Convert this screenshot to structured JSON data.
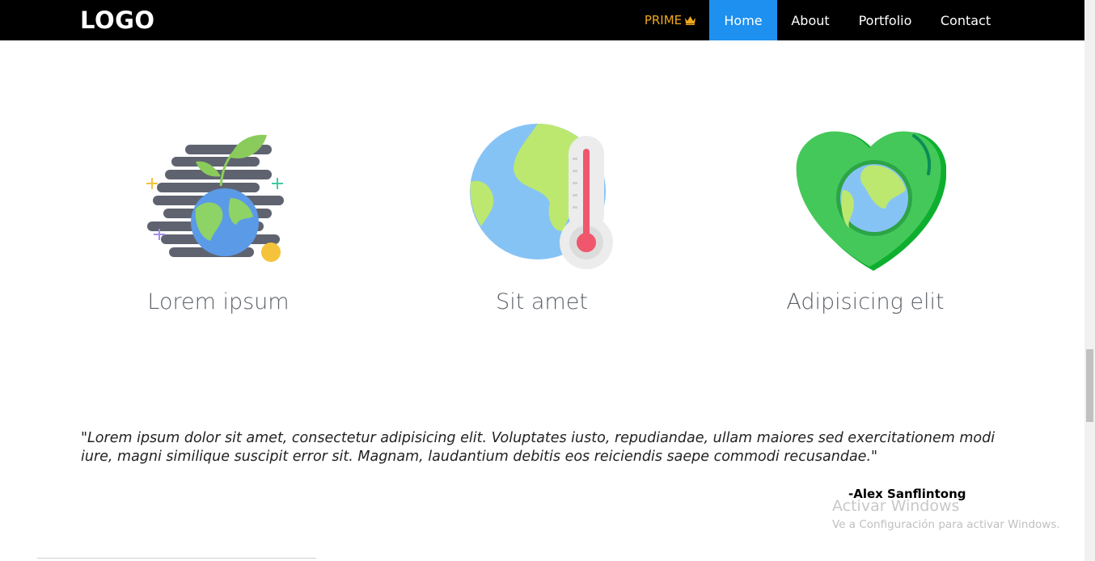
{
  "header": {
    "logo": "LOGO",
    "prime_label": "PRIME",
    "nav": [
      "Home",
      "About",
      "Portfolio",
      "Contact"
    ],
    "active_nav": "Home",
    "active_color": "#1e90ef"
  },
  "features": [
    {
      "label": "Lorem ipsum",
      "icon": "plant-earth-icon"
    },
    {
      "label": "Sit amet",
      "icon": "thermometer-earth-icon"
    },
    {
      "label": "Adipisicing elit",
      "icon": "heart-earth-icon"
    }
  ],
  "testimonial": {
    "quote": "\"Lorem ipsum dolor sit amet, consectetur adipisicing elit. Voluptates iusto, repudiandae, ullam maiores sed exercitationem modi iure, magni similique suscipit error sit. Magnam, laudantium debitis eos reiciendis saepe commodi recusandae.\"",
    "author": "-Alex Sanflintong"
  },
  "watermark": {
    "title": "Activar Windows",
    "subtitle": "Ve a Configuración para activar Windows."
  }
}
